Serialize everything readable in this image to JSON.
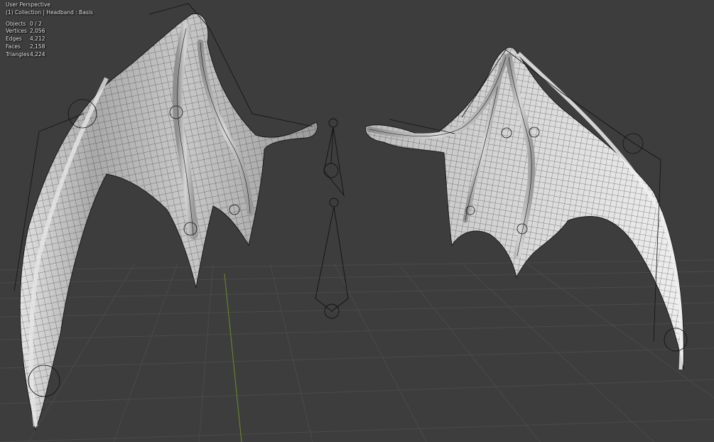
{
  "viewport": {
    "perspective_label": "User Perspective",
    "context_label": "(1) Collection | Headband : Basis"
  },
  "stats": [
    {
      "label": "Objects",
      "value": "0 / 2"
    },
    {
      "label": "Vertices",
      "value": "2,056"
    },
    {
      "label": "Edges",
      "value": "4,212"
    },
    {
      "label": "Faces",
      "value": "2,158"
    },
    {
      "label": "Triangles",
      "value": "4,224"
    }
  ],
  "colors": {
    "background": "#3d3d3d",
    "grid_line": "#4a4a4a",
    "axis_y": "#6a8f2a",
    "mesh_fill": "#bcbcbc",
    "wire": "#141414"
  }
}
